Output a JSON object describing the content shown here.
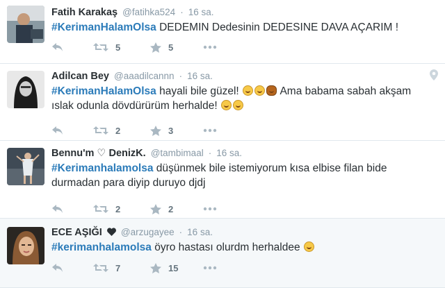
{
  "colors": {
    "hashtag": "#2b7bb9",
    "muted": "#8899a6",
    "icon": "#aab8c2",
    "highlight_bg": "#f5f8fa"
  },
  "tweets": [
    {
      "fullname": "Fatih Karakaş",
      "username": "@fatihka524",
      "time": "16 sa.",
      "hashtag": "#KerimanHalamOlsa",
      "text_after": " DEDEMIN Dedesinin DEDESINE DAVA AÇARIM !",
      "retweets": "5",
      "favorites": "5"
    },
    {
      "fullname": "Adilcan Bey",
      "username": "@aaadilcannn",
      "time": "16 sa.",
      "hashtag": "#KerimanHalamOlsa",
      "text_a": " hayali bile güzel!",
      "text_b": " Ama babama sabah akşam",
      "text_line2": "ıslak odunla dövdürürüm herhalde!",
      "retweets": "2",
      "favorites": "3"
    },
    {
      "fullname": "Bennu'm ♡ DenizK.",
      "username": "@tambimaal",
      "time": "16 sa.",
      "hashtag": "#Kerimanhalamolsa",
      "text_after": " düşünmek bile istemiyorum kısa elbise filan bide",
      "text_line2": "durmadan para diyip duruyo djdj",
      "retweets": "2",
      "favorites": "2"
    },
    {
      "fullname": "ECE AŞIĞI",
      "username": "@arzugayee",
      "time": "16 sa.",
      "hashtag": "#kerimanhalamolsa",
      "text_after": " öyro hastası olurdm herhaldee",
      "retweets": "7",
      "favorites": "15"
    }
  ],
  "dot": "·"
}
